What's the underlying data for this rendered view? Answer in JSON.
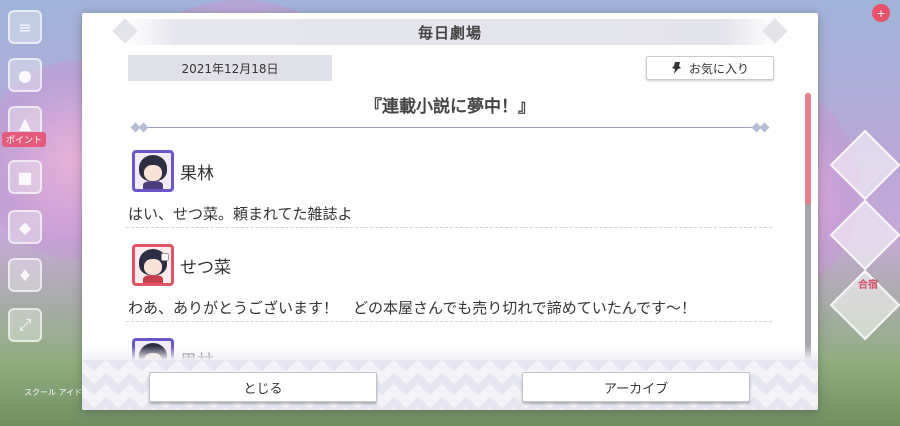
{
  "dialog": {
    "title": "毎日劇場",
    "date": "2021年12月18日",
    "favorite_label": "お気に入り",
    "episode_title": "『連載小説に夢中！』"
  },
  "dialogue": [
    {
      "speaker": "果林",
      "text": "はい、せつ菜。頼まれてた雑誌よ",
      "avatar_color": "#6a56c8"
    },
    {
      "speaker": "せつ菜",
      "text": "わあ、ありがとうございます！　どの本屋さんでも売り切れで諦めていたんです～！",
      "avatar_color": "#e05563"
    },
    {
      "speaker": "果林",
      "text": "",
      "avatar_color": "#6a56c8"
    }
  ],
  "footer": {
    "close_label": "とじる",
    "archive_label": "アーカイブ"
  },
  "background": {
    "badge_text": "ポイント",
    "right_label": "合宿",
    "bottom_text": "スクール\nアイド"
  },
  "colors": {
    "scroll_thumb": "#e57f8b",
    "accent_purple": "#6a56c8",
    "accent_red": "#e05563"
  },
  "icons": [
    "menu-icon",
    "pin-icon",
    "notification-badge"
  ]
}
